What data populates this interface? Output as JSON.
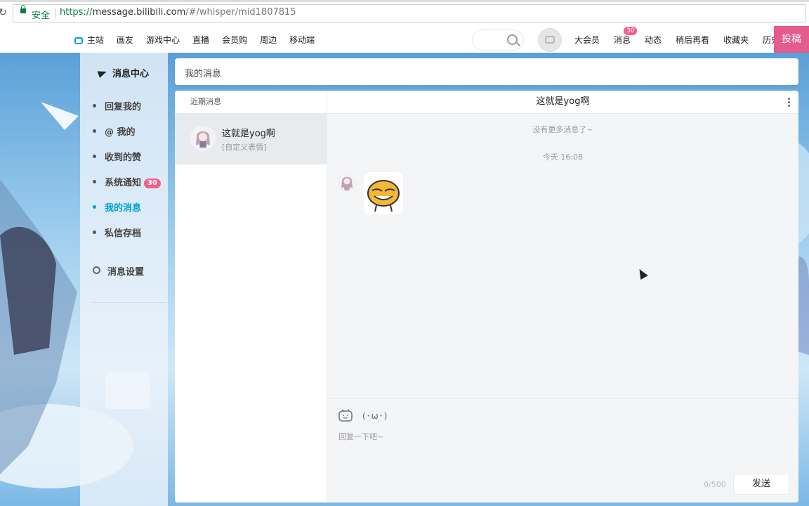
{
  "browser": {
    "secure_label": "安全",
    "url_proto": "https://",
    "url_host": "message.bilibili.com",
    "url_path": "/#/whisper/mid1807815"
  },
  "topnav": {
    "left_items": [
      "主站",
      "画友",
      "游戏中心",
      "直播",
      "会员购",
      "周边",
      "移动端"
    ],
    "right_items": [
      "大会员",
      "消息",
      "动态",
      "稍后再看",
      "收藏夹",
      "历史"
    ],
    "message_badge": "30",
    "upload_label": "投稿"
  },
  "sidebar": {
    "title": "消息中心",
    "items": [
      {
        "label": "回复我的"
      },
      {
        "label": "@ 我的"
      },
      {
        "label": "收到的赞"
      },
      {
        "label": "系统通知",
        "badge": "30"
      },
      {
        "label": "我的消息"
      },
      {
        "label": "私信存档"
      }
    ],
    "settings_label": "消息设置"
  },
  "header": {
    "title": "我的消息"
  },
  "conversations": {
    "header": "近期消息",
    "items": [
      {
        "name": "这就是yog啊",
        "preview": "[自定义表情]"
      }
    ]
  },
  "chat": {
    "title": "这就是yog啊",
    "no_more": "没有更多消息了~",
    "timestamp": "今天 16:08",
    "kaomoji": "(･ω･)",
    "reply_placeholder": "回复一下吧~",
    "char_count": "0/500",
    "send_label": "发送"
  },
  "colors": {
    "accent": "#00a1d6",
    "pink": "#f25d8e",
    "upload": "#e55b8d"
  }
}
